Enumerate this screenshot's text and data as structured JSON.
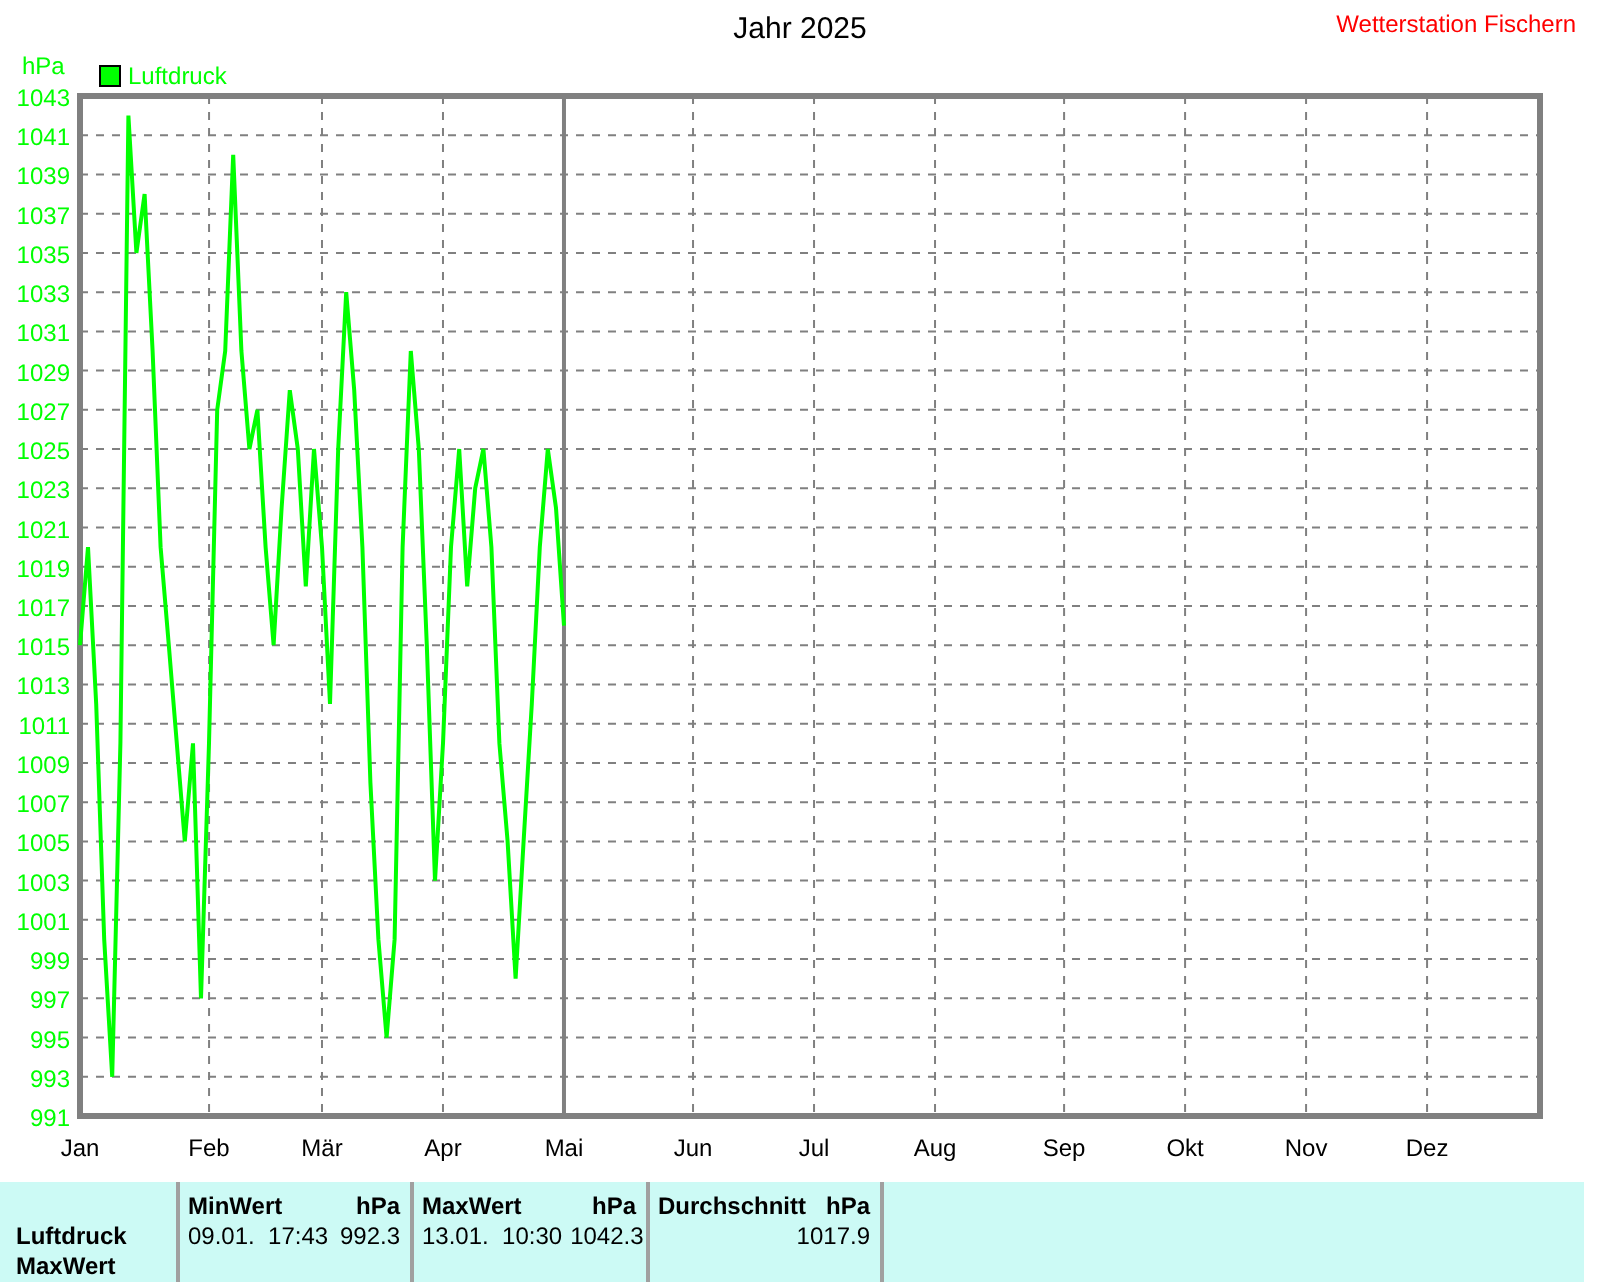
{
  "title": "Jahr 2025",
  "station": "Wetterstation Fischern",
  "chart": {
    "chart_data": {
      "type": "line",
      "ylabel": "hPa",
      "grid": true,
      "ylim": [
        991,
        1043
      ],
      "yticks": [
        991,
        993,
        995,
        997,
        999,
        1001,
        1003,
        1005,
        1007,
        1009,
        1011,
        1013,
        1015,
        1017,
        1019,
        1021,
        1023,
        1025,
        1027,
        1029,
        1031,
        1033,
        1035,
        1037,
        1039,
        1041,
        1043
      ],
      "categories": [
        "Jan",
        null,
        null,
        null,
        null,
        null,
        null,
        null,
        null,
        null,
        null,
        null,
        null,
        null,
        null,
        null,
        "Feb",
        null,
        null,
        null,
        null,
        null,
        null,
        null,
        null,
        null,
        null,
        null,
        null,
        null,
        "Mär",
        null,
        null,
        null,
        null,
        null,
        null,
        null,
        null,
        null,
        null,
        null,
        null,
        null,
        null,
        "Apr",
        null,
        null,
        null,
        null,
        null,
        null,
        null,
        null,
        null,
        null,
        null,
        null,
        null,
        null,
        "Mai",
        null,
        null,
        null,
        null,
        null,
        null,
        null,
        null,
        null,
        null,
        null,
        null,
        null,
        null,
        null,
        "Jun",
        null,
        null,
        null,
        null,
        null,
        null,
        null,
        null,
        null,
        null,
        null,
        null,
        null,
        null,
        "Jul",
        null,
        null,
        null,
        null,
        null,
        null,
        null,
        null,
        null,
        null,
        null,
        null,
        null,
        null,
        "Aug",
        null,
        null,
        null,
        null,
        null,
        null,
        null,
        null,
        null,
        null,
        null,
        null,
        null,
        null,
        null,
        "Sep",
        null,
        null,
        null,
        null,
        null,
        null,
        null,
        null,
        null,
        null,
        null,
        null,
        null,
        null,
        "Okt",
        null,
        null,
        null,
        null,
        null,
        null,
        null,
        null,
        null,
        null,
        null,
        null,
        null,
        null,
        "Nov",
        null,
        null,
        null,
        null,
        null,
        null,
        null,
        null,
        null,
        null,
        null,
        null,
        null,
        null,
        "Dez",
        null,
        null,
        null,
        null,
        null,
        null,
        null,
        null,
        null,
        null,
        null,
        null,
        null,
        null
      ],
      "series": [
        {
          "name": "Luftdruck",
          "color": "#00ff00",
          "values": [
            1015,
            1020,
            1012,
            1000,
            993,
            1010,
            1042,
            1035,
            1038,
            1030,
            1020,
            1015,
            1010,
            1005,
            1010,
            997,
            1010,
            1027,
            1030,
            1040,
            1030,
            1025,
            1027,
            1020,
            1015,
            1022,
            1028,
            1025,
            1018,
            1025,
            1020,
            1012,
            1025,
            1033,
            1028,
            1020,
            1008,
            1000,
            995,
            1000,
            1020,
            1030,
            1025,
            1015,
            1003,
            1010,
            1020,
            1025,
            1018,
            1023,
            1025,
            1020,
            1010,
            1005,
            998,
            1005,
            1012,
            1020,
            1025,
            1022,
            1016,
            null,
            null,
            null,
            null,
            null,
            null,
            null,
            null,
            null,
            null,
            null,
            null,
            null,
            null,
            null,
            null,
            null,
            null,
            null,
            null,
            null,
            null,
            null,
            null,
            null,
            null,
            null,
            null,
            null,
            null,
            null,
            null,
            null,
            null,
            null,
            null,
            null,
            null,
            null,
            null,
            null,
            null,
            null,
            null,
            null,
            null,
            null,
            null,
            null,
            null,
            null,
            null,
            null,
            null,
            null,
            null,
            null,
            null,
            null,
            null,
            null,
            null,
            null,
            null,
            null,
            null,
            null,
            null,
            null,
            null,
            null,
            null,
            null,
            null,
            null,
            null,
            null,
            null,
            null,
            null,
            null,
            null,
            null,
            null,
            null,
            null,
            null,
            null,
            null,
            null,
            null,
            null,
            null,
            null,
            null,
            null,
            null,
            null,
            null,
            null,
            null,
            null,
            null,
            null,
            null,
            null,
            null,
            null,
            null,
            null,
            null,
            null,
            null,
            null,
            null,
            null,
            null,
            null,
            null,
            null,
            null
          ]
        }
      ]
    }
  },
  "summary": {
    "row_labels": [
      "Luftdruck",
      "MaxWert"
    ],
    "columns": [
      {
        "title": "MinWert",
        "unit": "hPa",
        "time": "09.01.  17:43",
        "value": "992.3"
      },
      {
        "title": "MaxWert",
        "unit": "hPa",
        "time": "13.01.  10:30",
        "value": "1042.3"
      },
      {
        "title": "Durchschnitt",
        "unit": "hPa",
        "value": "1017.9"
      }
    ]
  }
}
